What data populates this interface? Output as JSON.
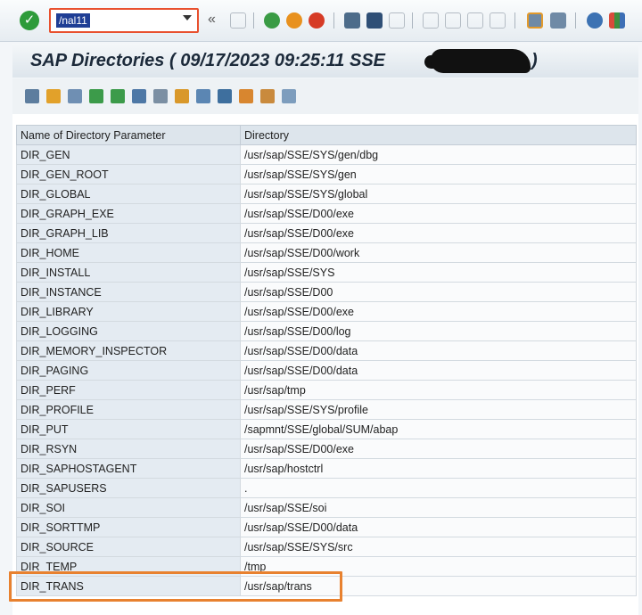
{
  "toolbar": {
    "command_value": "/nal11"
  },
  "title": {
    "text": "SAP Directories ( 09/17/2023 09:25:11 SSE",
    "close": ")"
  },
  "table": {
    "columns": [
      "Name of Directory Parameter",
      "Directory"
    ],
    "rows": [
      [
        "DIR_GEN",
        "/usr/sap/SSE/SYS/gen/dbg"
      ],
      [
        "DIR_GEN_ROOT",
        "/usr/sap/SSE/SYS/gen"
      ],
      [
        "DIR_GLOBAL",
        "/usr/sap/SSE/SYS/global"
      ],
      [
        "DIR_GRAPH_EXE",
        "/usr/sap/SSE/D00/exe"
      ],
      [
        "DIR_GRAPH_LIB",
        "/usr/sap/SSE/D00/exe"
      ],
      [
        "DIR_HOME",
        "/usr/sap/SSE/D00/work"
      ],
      [
        "DIR_INSTALL",
        "/usr/sap/SSE/SYS"
      ],
      [
        "DIR_INSTANCE",
        "/usr/sap/SSE/D00"
      ],
      [
        "DIR_LIBRARY",
        "/usr/sap/SSE/D00/exe"
      ],
      [
        "DIR_LOGGING",
        "/usr/sap/SSE/D00/log"
      ],
      [
        "DIR_MEMORY_INSPECTOR",
        "/usr/sap/SSE/D00/data"
      ],
      [
        "DIR_PAGING",
        "/usr/sap/SSE/D00/data"
      ],
      [
        "DIR_PERF",
        "/usr/sap/tmp"
      ],
      [
        "DIR_PROFILE",
        "/usr/sap/SSE/SYS/profile"
      ],
      [
        "DIR_PUT",
        "/sapmnt/SSE/global/SUM/abap"
      ],
      [
        "DIR_RSYN",
        "/usr/sap/SSE/D00/exe"
      ],
      [
        "DIR_SAPHOSTAGENT",
        "/usr/sap/hostctrl"
      ],
      [
        "DIR_SAPUSERS",
        "."
      ],
      [
        "DIR_SOI",
        "/usr/sap/SSE/soi"
      ],
      [
        "DIR_SORTTMP",
        "/usr/sap/SSE/D00/data"
      ],
      [
        "DIR_SOURCE",
        "/usr/sap/SSE/SYS/src"
      ],
      [
        "DIR_TEMP",
        "/tmp"
      ],
      [
        "DIR_TRANS",
        "/usr/sap/trans"
      ]
    ]
  },
  "colors": {
    "highlight": "#e8812f",
    "command_border": "#e8502e",
    "ok_green": "#2e9b3a"
  },
  "icons": {
    "system_toolbar": [
      "enter-check-icon",
      "back-icon",
      "exit-icon",
      "cancel-icon",
      "print-icon",
      "find-icon",
      "find-next-icon",
      "first-page-icon",
      "previous-page-icon",
      "next-page-icon",
      "last-page-icon",
      "create-session-icon",
      "shortcut-icon",
      "help-icon",
      "customize-layout-icon"
    ],
    "app_toolbar": [
      "details-icon",
      "refresh-icon",
      "find-icon",
      "sort-ascending-icon",
      "sort-descending-icon",
      "filter-icon",
      "total-icon",
      "export-icon",
      "print-preview-icon",
      "layout-icon",
      "grid-icon",
      "column-icon",
      "choose-layout-icon"
    ]
  }
}
